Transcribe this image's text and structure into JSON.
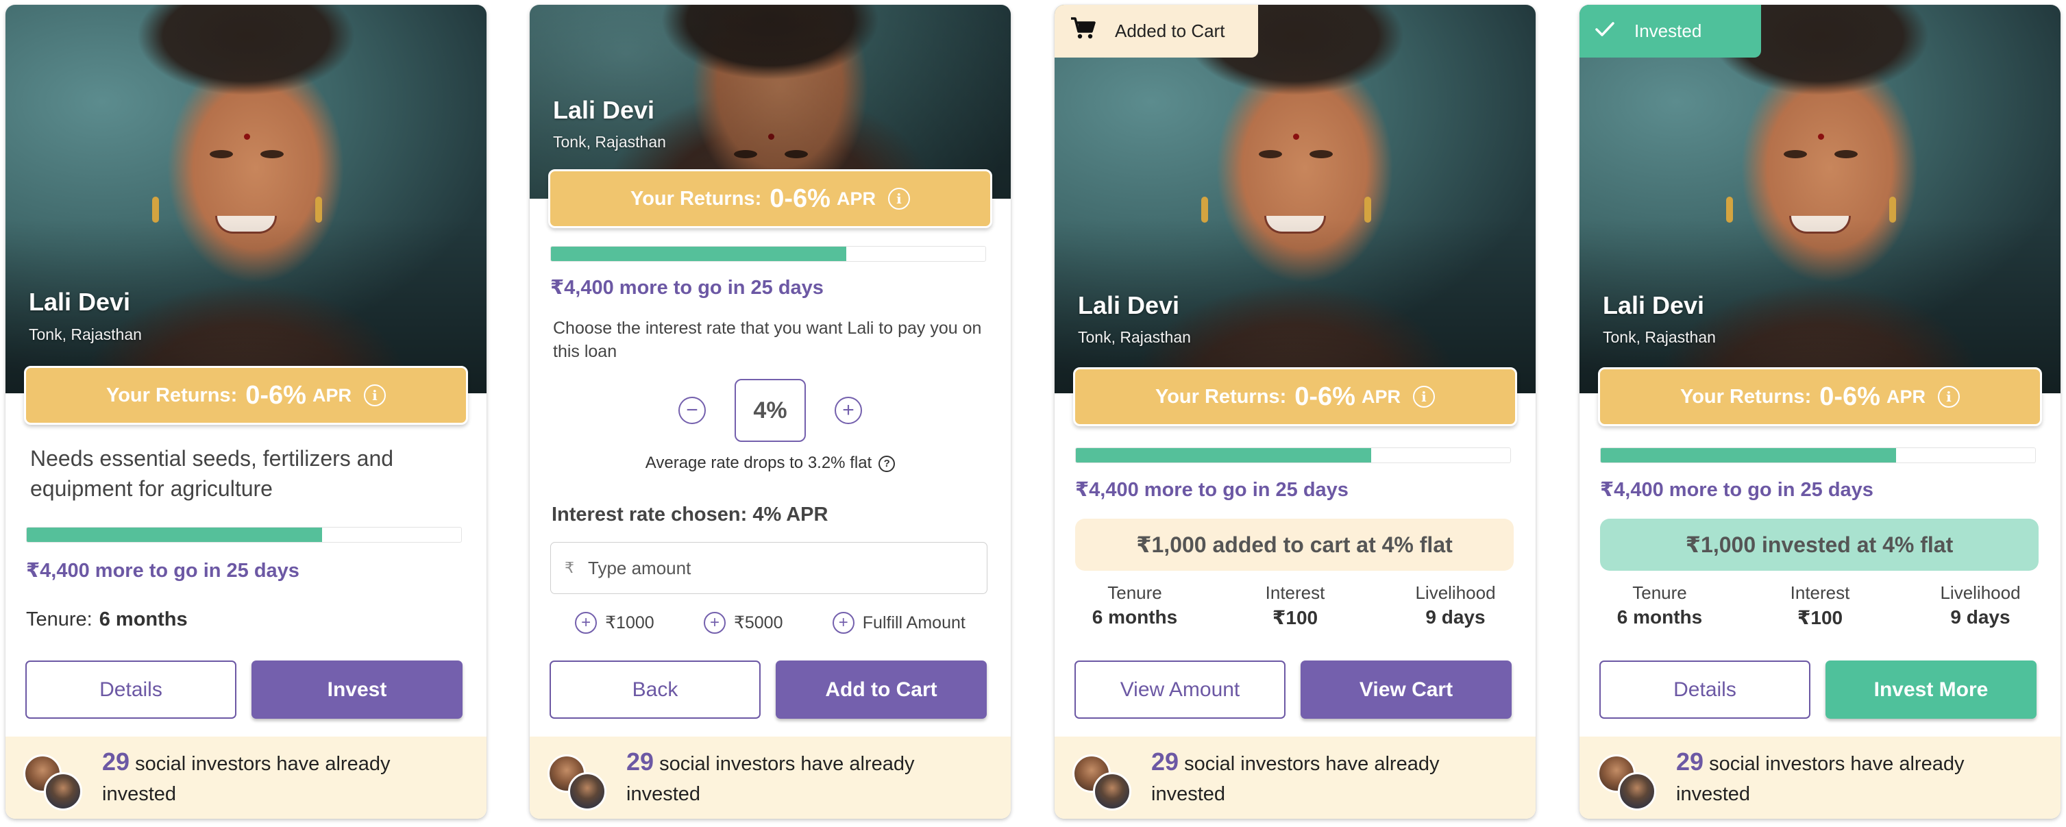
{
  "borrower": {
    "name": "Lali Devi",
    "location": "Tonk, Rajasthan",
    "description": "Needs essential seeds, fertilizers and equipment for agriculture"
  },
  "returns": {
    "label": "Your Returns:",
    "value": "0-6%",
    "unit": "APR",
    "info_icon": "info-icon"
  },
  "progress": {
    "funded_fraction": 0.68,
    "remaining_text": "₹4,400 more to go in 25 days"
  },
  "tenure": {
    "label": "Tenure:",
    "value": "6 months"
  },
  "social": {
    "count": "29",
    "text": "social investors have already invested"
  },
  "card1": {
    "details_label": "Details",
    "invest_label": "Invest"
  },
  "card2": {
    "chooser_text": "Choose the interest rate that you want Lali to pay you on this loan",
    "rate_value": "4%",
    "minus_symbol": "−",
    "plus_symbol": "+",
    "avg_text": "Average rate drops to 3.2% flat",
    "help_symbol": "?",
    "chosen_text": "Interest rate chosen: 4% APR",
    "amount_placeholder": "Type amount",
    "currency_symbol": "₹",
    "quick_amounts": [
      "₹1000",
      "₹5000",
      "Fulfill Amount"
    ],
    "back_label": "Back",
    "add_to_cart_label": "Add to Cart"
  },
  "stats": [
    {
      "label": "Tenure",
      "value": "6 months"
    },
    {
      "label": "Interest",
      "value": "₹100"
    },
    {
      "label": "Livelihood",
      "value": "9 days"
    }
  ],
  "card3": {
    "tag_label": "Added to Cart",
    "status_text": "₹1,000 added to cart at 4% flat",
    "view_amount_label": "View Amount",
    "view_cart_label": "View Cart"
  },
  "card4": {
    "tag_label": "Invested",
    "status_text": "₹1,000 invested at 4% flat",
    "details_label": "Details",
    "invest_more_label": "Invest More"
  },
  "colors": {
    "accent_purple": "#7460ad",
    "returns_gold": "#f0c56e",
    "progress_green": "#55c09a",
    "footer_cream": "#fdf3dc",
    "invested_green": "#4fc19b"
  },
  "icons": {
    "cart": "cart-icon",
    "check": "check-icon",
    "info": "info-icon",
    "help": "help-icon",
    "minus": "minus-circle-icon",
    "plus": "plus-circle-icon"
  }
}
